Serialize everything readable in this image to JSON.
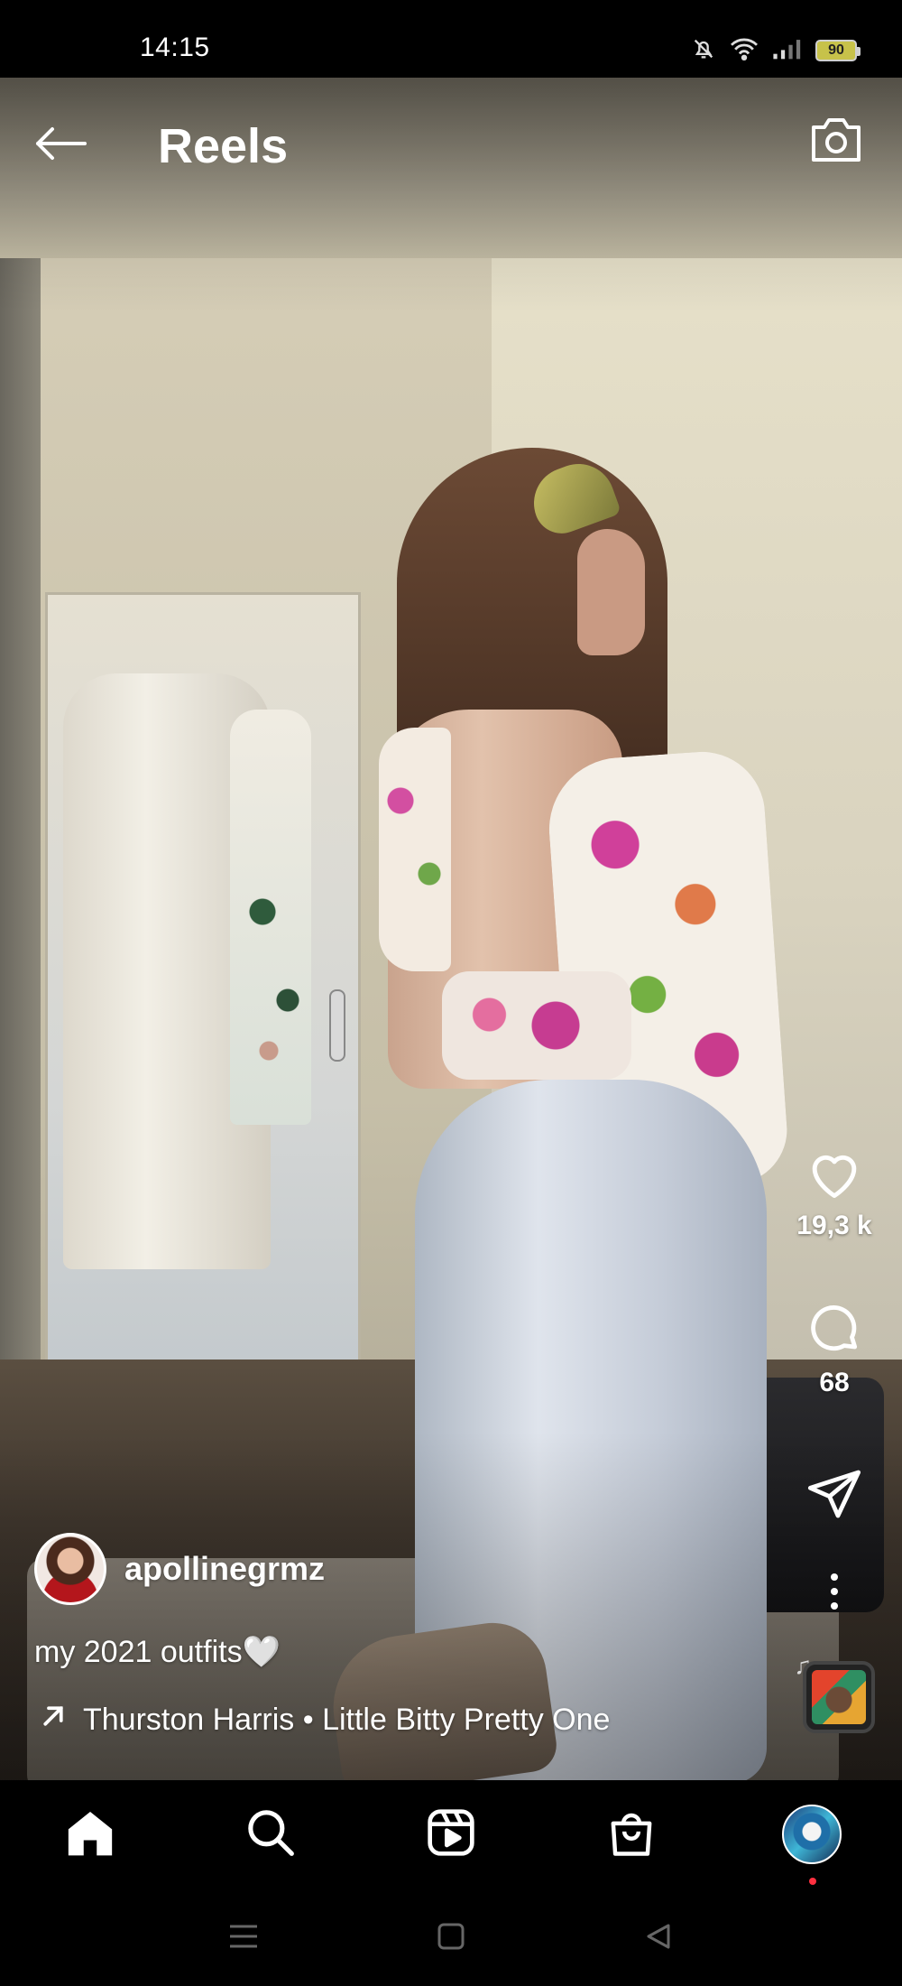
{
  "status_bar": {
    "time": "14:15",
    "battery": "90",
    "icons": [
      "mute-bell-icon",
      "wifi-icon",
      "signal-icon",
      "battery-icon"
    ]
  },
  "header": {
    "title": "Reels",
    "back_icon": "arrow-left-icon",
    "camera_icon": "camera-icon"
  },
  "actions": {
    "likes": "19,3 k",
    "comments": "68",
    "icons": [
      "heart-icon",
      "comment-icon",
      "send-icon",
      "more-vertical-icon"
    ]
  },
  "post": {
    "username": "apollinegrmz",
    "caption": "my 2021 outfits🤍",
    "audio": "Thurston Harris • Little Bitty Pretty One"
  },
  "bottom_nav": {
    "items": [
      "home-icon",
      "search-icon",
      "reels-icon",
      "shop-icon",
      "profile-avatar"
    ],
    "active": "home",
    "profile_dot_color": "#ff3040"
  },
  "system_nav": {
    "items": [
      "menu-icon",
      "home-square-icon",
      "back-triangle-icon"
    ]
  },
  "colors": {
    "background": "#000000",
    "text": "#ffffff"
  }
}
